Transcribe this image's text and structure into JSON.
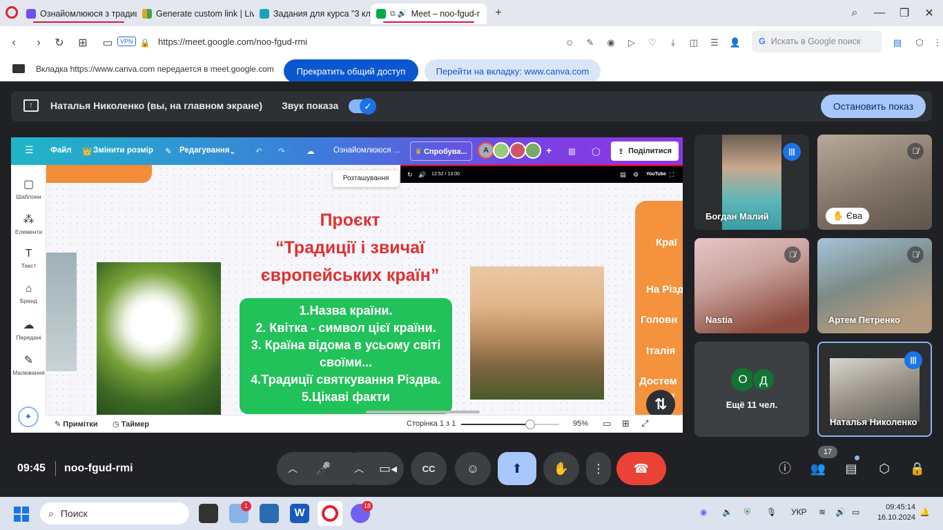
{
  "browser": {
    "tabs": [
      {
        "label": "Ознайомлююся з традиц",
        "color": "#6f4ef2"
      },
      {
        "label": "Generate custom link | Liv",
        "color": "#e4a32b"
      },
      {
        "label": "Задания для курса \"3 кла",
        "color": "#1aa3b8"
      },
      {
        "label": "Meet – noo-fgud-r",
        "color": "#00ac47"
      }
    ],
    "url": "https://meet.google.com/noo-fgud-rmi",
    "vpn": "VPN",
    "search_placeholder": "Искать в Google поиск"
  },
  "share_banner": {
    "info": "Вкладка https://www.canva.com передается в meet.google.com",
    "stop": "Прекратить общий доступ",
    "goto": "Перейти на вкладку: www.canva.com"
  },
  "presenting": {
    "name": "Наталья Николенко (вы, на главном экране)",
    "sound": "Звук показа",
    "stop": "Остановить показ"
  },
  "canva": {
    "menu": {
      "file": "Файл",
      "resize": "Змінити розмір",
      "edit": "Редагування",
      "doc_title": "Ознайомлююся ...",
      "try": "Спробува...",
      "avatar_letter": "A",
      "share": "Поділитися"
    },
    "sidebar": [
      {
        "label": "Шаблони",
        "icon": "templates-icon",
        "glyph": "▢"
      },
      {
        "label": "Елементи",
        "icon": "elements-icon",
        "glyph": "⁂"
      },
      {
        "label": "Текст",
        "icon": "text-icon",
        "glyph": "T"
      },
      {
        "label": "Бренд",
        "icon": "brand-icon",
        "glyph": "⌂"
      },
      {
        "label": "Передані",
        "icon": "upload-icon",
        "glyph": "☁"
      },
      {
        "label": "Малювання",
        "icon": "draw-icon",
        "glyph": "✎"
      }
    ],
    "video": {
      "time": "12:52 / 13:00",
      "brand": "YouTube"
    },
    "tooltip": "Розташування",
    "slide": {
      "title_1": "Проєкт",
      "title_2": "“Традиції і звичаї",
      "title_3": "європейських країн”",
      "items": [
        "1.Назва країни.",
        "2. Квітка - символ цієї країни.",
        "3. Країна відома в усьому світі своїми...",
        "4.Традиції святкування Різдва.",
        "5.Цікаві факти"
      ],
      "right_panel": [
        "Краї",
        "На Різд",
        "Головн",
        "Італія",
        "Достем",
        "краї"
      ]
    },
    "footer": {
      "notes": "Примітки",
      "timer": "Таймер",
      "page": "Сторінка 1 з 1",
      "zoom": "95%",
      "zoom_level": 0.95
    }
  },
  "participants": [
    {
      "name": "Богдан Малий",
      "state": "speaking",
      "bg": "#5b8f98"
    },
    {
      "name": "Єва",
      "state": "muted",
      "bg": "#8a7f73"
    },
    {
      "name": "Nastia",
      "state": "muted",
      "bg": "#b38c86"
    },
    {
      "name": "Артем Петренко",
      "state": "muted",
      "bg": "#77858c"
    },
    {
      "name": "Наталья Николенко",
      "state": "speaking",
      "bg": "#8a8a80"
    }
  ],
  "more": {
    "label": "Ещё 11 чел.",
    "initials": [
      "O",
      "Д"
    ]
  },
  "meeting": {
    "time": "09:45",
    "code": "noo-fgud-rmi",
    "people_count": "17"
  },
  "taskbar": {
    "search": "Поиск",
    "lang": "УКР",
    "clock": "09:45:14",
    "date": "16.10.2024",
    "weather_badge": "1",
    "viber_badge": "18"
  }
}
